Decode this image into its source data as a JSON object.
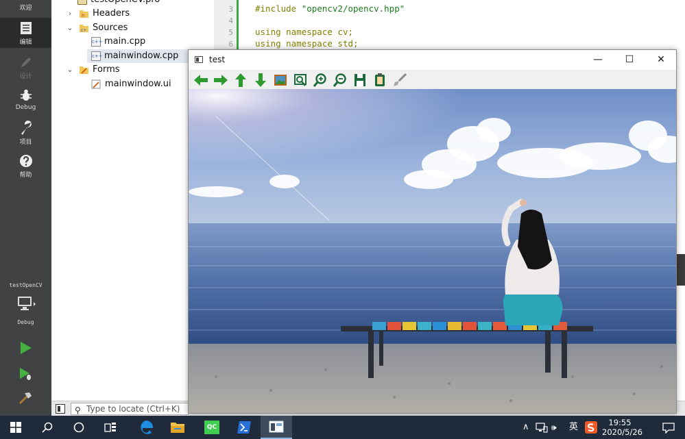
{
  "modebar": {
    "welcome": "欢迎",
    "edit": "编辑",
    "design": "设计",
    "debug": "Debug",
    "projects": "项目",
    "help": "帮助",
    "kit_project": "testOpenCV",
    "kit_build": "Debug"
  },
  "tree": {
    "pro_file": "testOpenCV.pro",
    "headers": "Headers",
    "sources": "Sources",
    "main_cpp": "main.cpp",
    "mainwindow_cpp": "mainwindow.cpp",
    "forms": "Forms",
    "mainwindow_ui": "mainwindow.ui",
    "cpp_badge": "c++",
    "header_badge": "h"
  },
  "locator": {
    "placeholder": "Type to locate (Ctrl+K)"
  },
  "editor": {
    "lines": [
      {
        "num": "3",
        "text": "#include \"opencv2/opencv.hpp\""
      },
      {
        "num": "4",
        "text": ""
      },
      {
        "num": "5",
        "text": "using namespace cv;"
      },
      {
        "num": "6",
        "text": "using namespace std;"
      }
    ],
    "include_kw": "#include",
    "include_str": "\"opencv2/opencv.hpp\"",
    "using_kw": "using namespace",
    "ns_cv": "cv;",
    "ns_std": "std;"
  },
  "window": {
    "title": "test",
    "minimize": "—",
    "maximize": "☐",
    "close": "✕"
  },
  "taskbar": {
    "qc_label": "QC",
    "tray_chevron": "∧",
    "tray_volume": "🕪",
    "ime": "英",
    "time": "19:55",
    "date": "2020/5/26"
  },
  "colors": {
    "qt_sidebar": "#404244",
    "qt_green": "#3aa84a",
    "taskbar": "#1f2a3a",
    "arrow_green": "#2f9a2f"
  }
}
